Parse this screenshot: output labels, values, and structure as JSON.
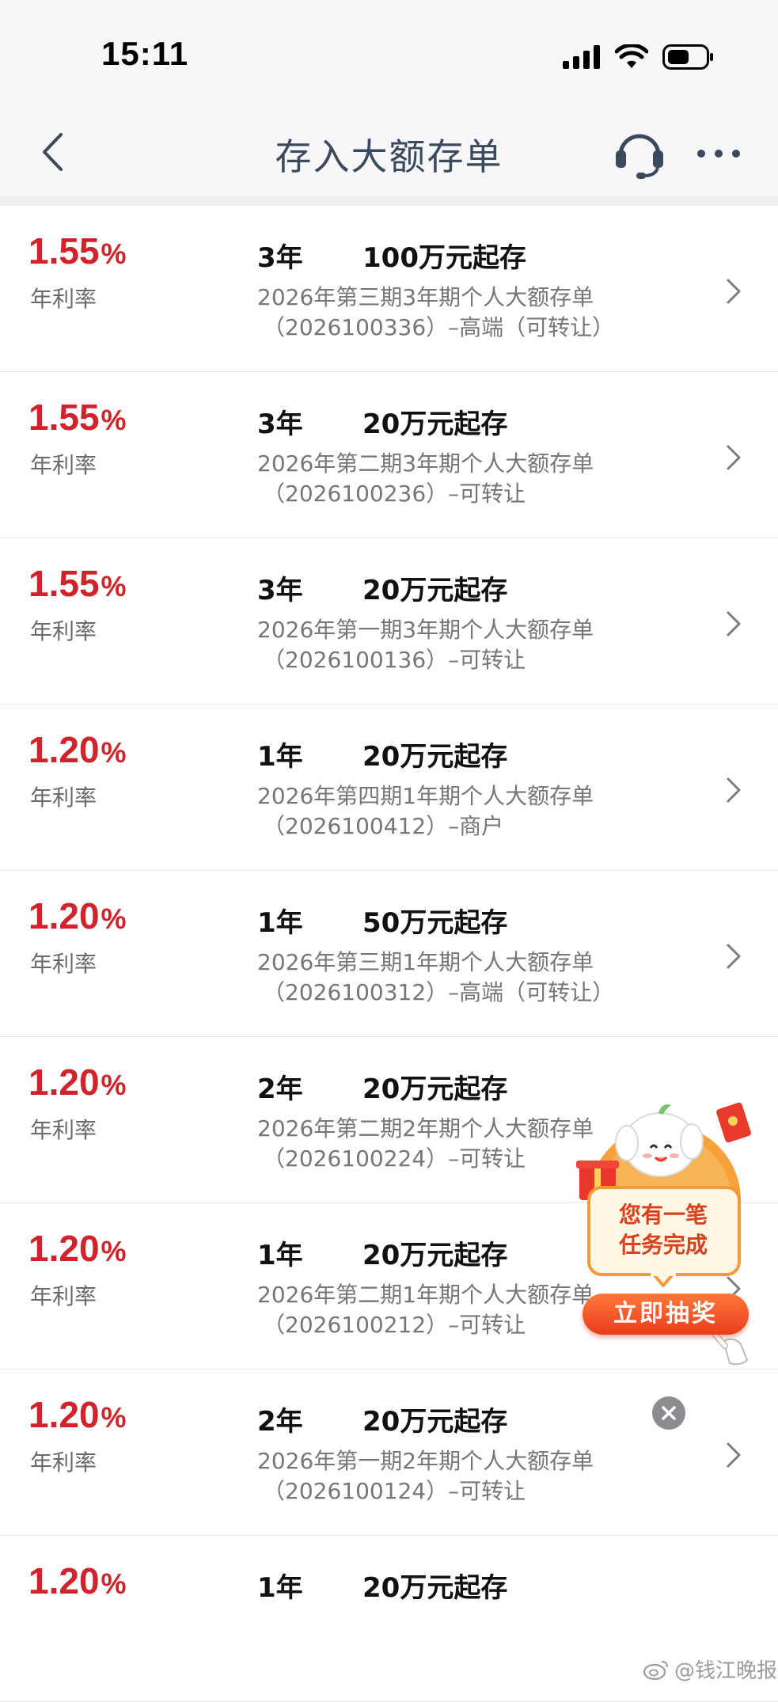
{
  "status_bar": {
    "time": "15:11"
  },
  "header": {
    "title": "存入大额存单",
    "back_icon": "chevron-left-icon",
    "support_icon": "headset-icon",
    "more_icon": "more-dots-icon"
  },
  "colors": {
    "rate": "#d0232b",
    "title": "#3a4a5c",
    "secondary_text": "#75757a"
  },
  "products": [
    {
      "rate": "1.55",
      "pct": "%",
      "rate_label": "年利率",
      "term": "3年",
      "min": "100万元起存",
      "name": "2026年第三期3年期个人大额存单",
      "code": "（2026100336）–高端（可转让）"
    },
    {
      "rate": "1.55",
      "pct": "%",
      "rate_label": "年利率",
      "term": "3年",
      "min": "20万元起存",
      "name": "2026年第二期3年期个人大额存单",
      "code": "（2026100236）–可转让"
    },
    {
      "rate": "1.55",
      "pct": "%",
      "rate_label": "年利率",
      "term": "3年",
      "min": "20万元起存",
      "name": "2026年第一期3年期个人大额存单",
      "code": "（2026100136）–可转让"
    },
    {
      "rate": "1.20",
      "pct": "%",
      "rate_label": "年利率",
      "term": "1年",
      "min": "20万元起存",
      "name": "2026年第四期1年期个人大额存单",
      "code": "（2026100412）–商户"
    },
    {
      "rate": "1.20",
      "pct": "%",
      "rate_label": "年利率",
      "term": "1年",
      "min": "50万元起存",
      "name": "2026年第三期1年期个人大额存单",
      "code": "（2026100312）–高端（可转让）"
    },
    {
      "rate": "1.20",
      "pct": "%",
      "rate_label": "年利率",
      "term": "2年",
      "min": "20万元起存",
      "name": "2026年第二期2年期个人大额存单",
      "code": "（2026100224）–可转让"
    },
    {
      "rate": "1.20",
      "pct": "%",
      "rate_label": "年利率",
      "term": "1年",
      "min": "20万元起存",
      "name": "2026年第二期1年期个人大额存单",
      "code": "（2026100212）–可转让"
    },
    {
      "rate": "1.20",
      "pct": "%",
      "rate_label": "年利率",
      "term": "2年",
      "min": "20万元起存",
      "name": "2026年第一期2年期个人大额存单",
      "code": "（2026100124）–可转让"
    },
    {
      "rate": "1.20",
      "pct": "%",
      "rate_label": "",
      "term": "1年",
      "min": "20万元起存",
      "name": "",
      "code": ""
    }
  ],
  "promo": {
    "message_line1": "您有一笔",
    "message_line2": "任务完成",
    "button_label": "立即抽奖",
    "close_icon": "close-icon"
  },
  "watermark": {
    "text": "@钱江晚报"
  }
}
